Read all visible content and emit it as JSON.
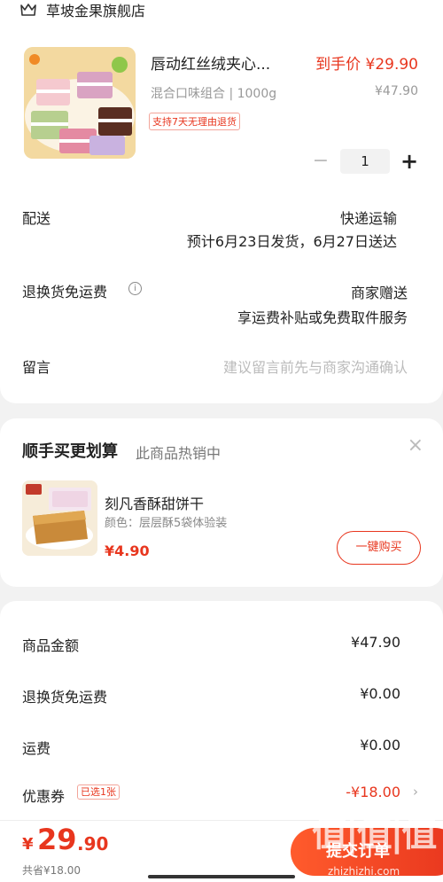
{
  "store": {
    "name": "草坡金果旗舰店",
    "icon": "store-icon"
  },
  "product": {
    "title": "唇动红丝绒夹心...",
    "price_label": "到手价 ¥29.90",
    "spec": "混合口味组合 | 1000g",
    "original_price": "¥47.90",
    "refund_tag": "支持7天无理由退货",
    "quantity": "1",
    "minus_symbol": "−",
    "plus_symbol": "+"
  },
  "delivery": {
    "label": "配送",
    "method": "快递运输",
    "schedule": "预计6月23日发货，6月27日送达"
  },
  "return_shipping": {
    "label": "退换货免运费",
    "value": "商家赠送",
    "detail": "享运费补贴或免费取件服务"
  },
  "message": {
    "label": "留言",
    "placeholder": "建议留言前先与商家沟通确认"
  },
  "recommend": {
    "title": "顺手买更划算",
    "subtitle": "此商品热销中",
    "close": "×",
    "name": "刻凡香酥甜饼干",
    "spec": "颜色：层层酥5袋体验装",
    "price": "¥4.90",
    "button": "一键购买"
  },
  "summary": {
    "items": [
      {
        "label": "商品金额",
        "value": "¥47.90"
      },
      {
        "label": "退换货免运费",
        "value": "¥0.00"
      },
      {
        "label": "运费",
        "value": "¥0.00"
      }
    ],
    "coupon_label": "优惠券",
    "coupon_badge": "已选1张",
    "coupon_value": "-¥18.00",
    "coupon_arrow": "›"
  },
  "bottom": {
    "currency": "¥",
    "total_int": "29",
    "total_dec": ".90",
    "saved": "共省¥18.00",
    "submit": "提交订单"
  },
  "watermark": {
    "text": "值|值|值",
    "url": "zhizhizhi.com"
  },
  "colors": {
    "accent": "#e8361e",
    "background": "#f2f2f2"
  }
}
